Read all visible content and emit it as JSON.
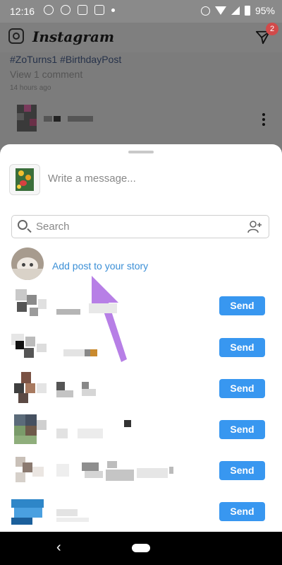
{
  "status_bar": {
    "time": "12:16",
    "battery": "95%"
  },
  "app_bar": {
    "logo": "Instagram",
    "dm_badge": "2",
    "icons": [
      "camera-icon",
      "direct-message-icon"
    ]
  },
  "feed": {
    "hashtags": "#ZoTurns1 #BirthdayPost",
    "view_comments": "View 1 comment",
    "timestamp": "14 hours ago"
  },
  "share_sheet": {
    "message_placeholder": "Write a message...",
    "search_placeholder": "Search",
    "add_to_story": "Add post to your story",
    "send_label": "Send",
    "recipient_count": 6,
    "accent_color": "#3897f0"
  },
  "nav": {
    "back_icon": "back-chevron-icon",
    "home_icon": "home-pill-icon"
  }
}
